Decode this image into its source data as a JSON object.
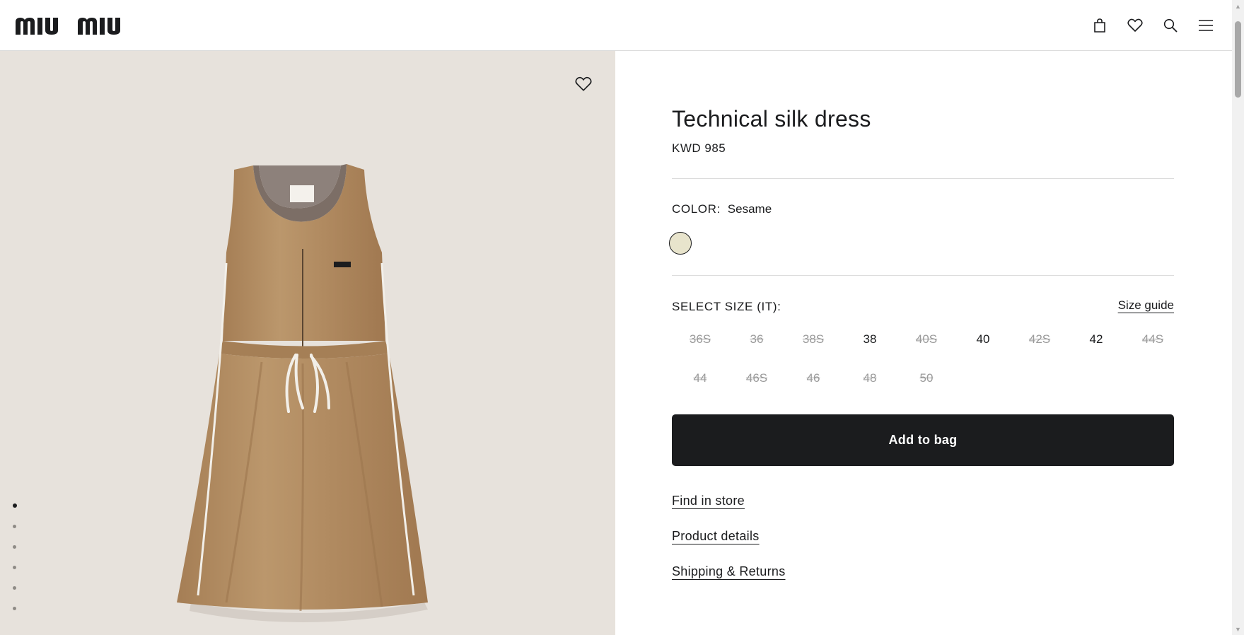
{
  "brand": {
    "name": "MIU MIU"
  },
  "header": {
    "icons": [
      "shopping-bag-icon",
      "heart-icon",
      "search-icon",
      "menu-icon"
    ]
  },
  "gallery": {
    "image": "dress-image",
    "label_text": "MIU MIU",
    "dots_count": 6,
    "active_dot": 1
  },
  "product": {
    "title": "Technical silk dress",
    "price": "KWD 985",
    "color_label": "COLOR:",
    "color_value": "Sesame",
    "swatch_color": "#e8e4cc",
    "size_label": "SELECT SIZE (IT):",
    "size_guide": "Size guide",
    "sizes": [
      {
        "label": "36S",
        "available": false
      },
      {
        "label": "36",
        "available": false
      },
      {
        "label": "38S",
        "available": false
      },
      {
        "label": "38",
        "available": true
      },
      {
        "label": "40S",
        "available": false
      },
      {
        "label": "40",
        "available": true
      },
      {
        "label": "42S",
        "available": false
      },
      {
        "label": "42",
        "available": true
      },
      {
        "label": "44S",
        "available": false
      },
      {
        "label": "44",
        "available": false
      },
      {
        "label": "46S",
        "available": false
      },
      {
        "label": "46",
        "available": false
      },
      {
        "label": "48",
        "available": false
      },
      {
        "label": "50",
        "available": false
      }
    ],
    "add_to_bag": "Add to bag",
    "links": {
      "find_in_store": "Find in store",
      "product_details": "Product details",
      "shipping_returns": "Shipping & Returns"
    }
  },
  "colors": {
    "gallery_bg": "#e7e2dc",
    "button_bg": "#1b1c1e",
    "dress": "#b48e64"
  }
}
